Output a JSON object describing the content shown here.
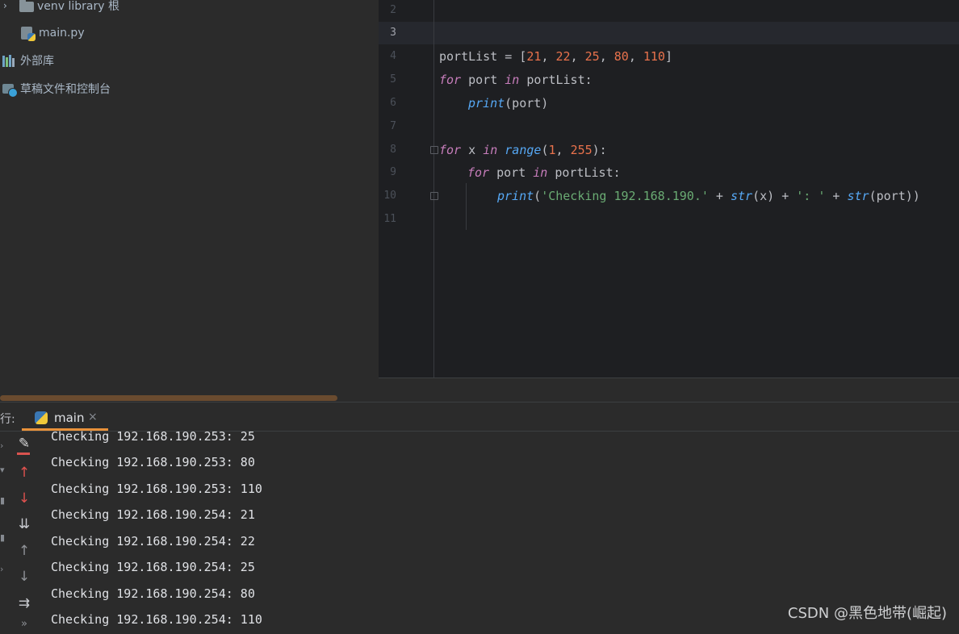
{
  "project_tree": {
    "items": [
      {
        "label": "venv  library 根",
        "icon": "folder-icon"
      },
      {
        "label": "main.py",
        "icon": "python-file-icon"
      },
      {
        "label": "外部库",
        "icon": "external-libraries-icon"
      },
      {
        "label": "草稿文件和控制台",
        "icon": "scratches-console-icon"
      }
    ]
  },
  "editor": {
    "line_numbers": [
      "2",
      "3",
      "4",
      "5",
      "6",
      "7",
      "8",
      "9",
      "10",
      "11"
    ],
    "current_line": "3",
    "code": {
      "l4_var": "portList",
      "l4_eq": " = [",
      "l4_n1": "21",
      "l4_n2": "22",
      "l4_n3": "25",
      "l4_n4": "80",
      "l4_n5": "110",
      "l5_for": "for",
      "l5_port": " port ",
      "l5_in": "in",
      "l5_list": " portList:",
      "l6_print": "print",
      "l6_rest": "(port)",
      "l8_for": "for",
      "l8_x": " x ",
      "l8_in": "in",
      "l8_range": "range",
      "l8_open": "(",
      "l8_a": "1",
      "l8_b": "255",
      "l8_close": "):",
      "l9_for": "for",
      "l9_port": " port ",
      "l9_in": "in",
      "l9_list": " portList:",
      "l10_print": "print",
      "l10_str1": "'Checking 192.168.190.'",
      "l10_plus1": " + ",
      "l10_strfn1": "str",
      "l10_x": "(x) + ",
      "l10_str2": "': '",
      "l10_plus2": " + ",
      "l10_strfn2": "str",
      "l10_port": "(port))"
    }
  },
  "run_panel": {
    "label": "行:",
    "tab_name": "main",
    "tab_close": "×",
    "tools": [
      {
        "name": "clear-icon",
        "glyph": "✎"
      },
      {
        "name": "up-red-icon",
        "glyph": "↑"
      },
      {
        "name": "down-red-icon",
        "glyph": "↓"
      },
      {
        "name": "sort-icon",
        "glyph": "⇊"
      },
      {
        "name": "up-arrow-icon",
        "glyph": "↑"
      },
      {
        "name": "down-arrow-icon",
        "glyph": "↓"
      },
      {
        "name": "soft-wrap-icon",
        "glyph": "⇉"
      },
      {
        "name": "more-icon",
        "glyph": "»"
      }
    ],
    "output": [
      "Checking 192.168.190.253: 25",
      "Checking 192.168.190.253: 80",
      "Checking 192.168.190.253: 110",
      "Checking 192.168.190.254: 21",
      "Checking 192.168.190.254: 22",
      "Checking 192.168.190.254: 25",
      "Checking 192.168.190.254: 80",
      "Checking 192.168.190.254: 110"
    ]
  },
  "watermark": "CSDN @黑色地带(崛起)",
  "colors": {
    "editor_bg": "#1e1f22",
    "panel_bg": "#2b2b2b",
    "accent": "#e8913a",
    "keyword": "#cf8e6d",
    "number": "#2aacb8",
    "string": "#6aab73",
    "function": "#56a8f5"
  }
}
